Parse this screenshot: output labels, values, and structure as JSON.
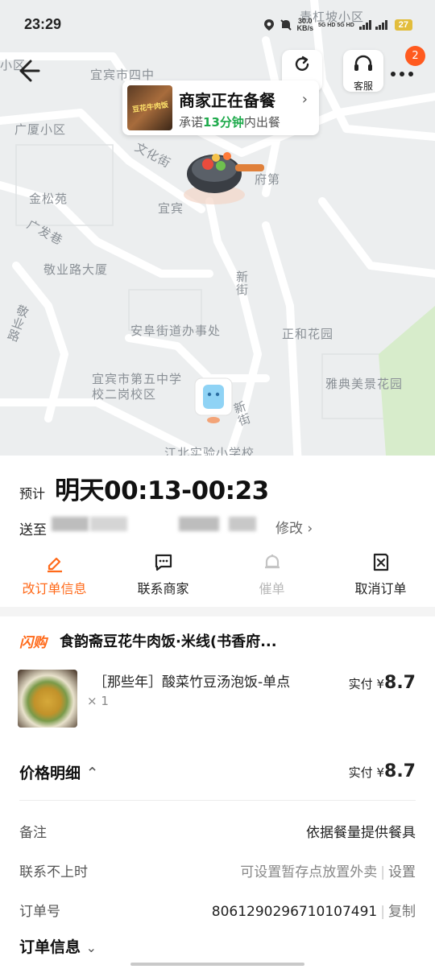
{
  "status_bar": {
    "time": "23:29",
    "speed_value": "30.0",
    "speed_unit": "KB/s",
    "network": "5G HD 5G HD",
    "battery": "27"
  },
  "map": {
    "labels": [
      "青杠坡小区",
      "小区",
      "宜宾市四中",
      "广厦小区",
      "文化街",
      "府第",
      "金松苑",
      "宜宾",
      "广发巷",
      "敬业路大厦",
      "新街",
      "敬业路",
      "安阜街道办事处",
      "正和花园",
      "宜宾市第五中学校二岗校区",
      "雅典美景花园",
      "新街",
      "江北实验小学校"
    ]
  },
  "top_controls": {
    "refresh_label": "刷新",
    "service_label": "客服",
    "badge_count": "2"
  },
  "merchant_bubble": {
    "title": "商家正在备餐",
    "sub_prefix": "承诺",
    "sub_highlight": "13分钟",
    "sub_suffix": "内出餐",
    "thumb_text": "豆花牛肉饭"
  },
  "delivery": {
    "eta_label": "预计",
    "eta_time": "明天00:13-00:23",
    "address_label": "送至",
    "modify_label": "修改 ›"
  },
  "actions": [
    {
      "label": "改订单信息",
      "icon": "edit-icon"
    },
    {
      "label": "联系商家",
      "icon": "chat-icon"
    },
    {
      "label": "催单",
      "icon": "bell-icon"
    },
    {
      "label": "取消订单",
      "icon": "cancel-doc-icon"
    }
  ],
  "order": {
    "shop_tag": "闪购",
    "shop_name": "食韵斋豆花牛肉饭·米线(书香府...",
    "item_name": "［那些年］酸菜竹豆汤泡饭-单点",
    "item_qty": "× 1",
    "paid_label": "实付",
    "currency": "¥",
    "item_price": "8.7",
    "price_detail_title": "价格明细",
    "total_price": "8.7"
  },
  "details": {
    "note_label": "备注",
    "note_value": "依据餐量提供餐具",
    "unreachable_label": "联系不上时",
    "unreachable_value": "可设置暂存点放置外卖",
    "unreachable_action": "设置",
    "order_no_label": "订单号",
    "order_no_value": "8061290296710107491",
    "order_no_action": "复制",
    "order_info_title": "订单信息"
  },
  "colors": {
    "accent": "#ff6a1a",
    "green": "#1faa4c",
    "badge": "#ff5a1f"
  }
}
